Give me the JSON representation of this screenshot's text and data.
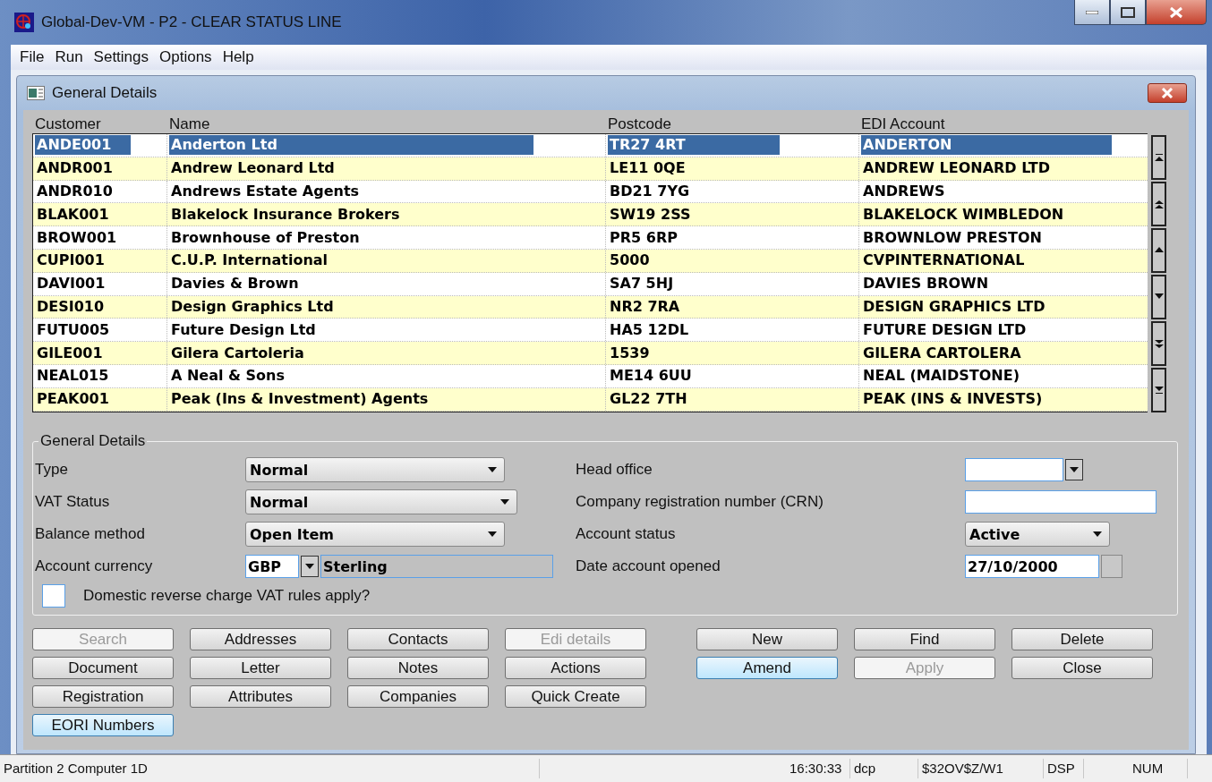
{
  "window": {
    "title": "Global-Dev-VM - P2 - CLEAR STATUS LINE"
  },
  "menu": [
    "File",
    "Run",
    "Settings",
    "Options",
    "Help"
  ],
  "child_window": {
    "title": "General Details"
  },
  "table": {
    "columns": [
      "Customer",
      "Name",
      "Postcode",
      "EDI Account"
    ],
    "rows": [
      {
        "cells": [
          "ANDE001",
          "Anderton Ltd",
          "TR27 4RT",
          "ANDERTON"
        ],
        "selected": true
      },
      {
        "cells": [
          "ANDR001",
          "Andrew Leonard Ltd",
          "LE11 0QE",
          "ANDREW LEONARD LTD"
        ],
        "selected": false
      },
      {
        "cells": [
          "ANDR010",
          "Andrews Estate Agents",
          "BD21 7YG",
          "ANDREWS"
        ],
        "selected": false
      },
      {
        "cells": [
          "BLAK001",
          "Blakelock Insurance Brokers",
          "SW19 2SS",
          "BLAKELOCK WIMBLEDON"
        ],
        "selected": false
      },
      {
        "cells": [
          "BROW001",
          "Brownhouse of Preston",
          "PR5 6RP",
          "BROWNLOW PRESTON"
        ],
        "selected": false
      },
      {
        "cells": [
          "CUPI001",
          "C.U.P. International",
          "5000",
          "CVPINTERNATIONAL"
        ],
        "selected": false
      },
      {
        "cells": [
          "DAVI001",
          "Davies & Brown",
          "SA7 5HJ",
          "DAVIES BROWN"
        ],
        "selected": false
      },
      {
        "cells": [
          "DESI010",
          "Design Graphics Ltd",
          "NR2 7RA",
          "DESIGN GRAPHICS LTD"
        ],
        "selected": false
      },
      {
        "cells": [
          "FUTU005",
          "Future Design Ltd",
          "HA5 12DL",
          "FUTURE DESIGN LTD"
        ],
        "selected": false
      },
      {
        "cells": [
          "GILE001",
          "Gilera Cartoleria",
          "1539",
          "GILERA CARTOLERA"
        ],
        "selected": false
      },
      {
        "cells": [
          "NEAL015",
          "A Neal & Sons",
          "ME14 6UU",
          "NEAL (MAIDSTONE)"
        ],
        "selected": false
      },
      {
        "cells": [
          "PEAK001",
          "Peak (Ins & Investment) Agents",
          "GL22 7TH",
          "PEAK (INS & INVESTS)"
        ],
        "selected": false
      }
    ]
  },
  "general_details": {
    "title": "General Details",
    "left_fields": [
      {
        "label": "Type",
        "kind": "select",
        "value": "Normal"
      },
      {
        "label": "VAT Status",
        "kind": "select",
        "value": "Normal"
      },
      {
        "label": "Balance method",
        "kind": "select",
        "value": "Open Item"
      },
      {
        "label": "Account currency",
        "kind": "currency",
        "value": "GBP",
        "description": "Sterling"
      }
    ],
    "right_fields": [
      {
        "label": "Head office",
        "kind": "combo"
      },
      {
        "label": "Company registration number (CRN)",
        "kind": "text"
      },
      {
        "label": "Account status",
        "kind": "select",
        "value": "Active"
      },
      {
        "label": "Date account opened",
        "kind": "date",
        "value": "27/10/2000"
      }
    ],
    "checkbox": {
      "label": "Domestic reverse charge VAT rules apply?",
      "checked": false
    }
  },
  "left_buttons": [
    {
      "label": "Search",
      "disabled": true,
      "focused": false
    },
    {
      "label": "Addresses",
      "disabled": false,
      "focused": false
    },
    {
      "label": "Contacts",
      "disabled": false,
      "focused": false
    },
    {
      "label": "Edi details",
      "disabled": true,
      "focused": false
    },
    {
      "label": "Document",
      "disabled": false,
      "focused": false
    },
    {
      "label": "Letter",
      "disabled": false,
      "focused": false
    },
    {
      "label": "Notes",
      "disabled": false,
      "focused": false
    },
    {
      "label": "Actions",
      "disabled": false,
      "focused": false
    },
    {
      "label": "Registration",
      "disabled": false,
      "focused": false
    },
    {
      "label": "Attributes",
      "disabled": false,
      "focused": false
    },
    {
      "label": "Companies",
      "disabled": false,
      "focused": false
    },
    {
      "label": "Quick Create",
      "disabled": false,
      "focused": false
    },
    {
      "label": "EORI Numbers",
      "disabled": false,
      "focused": true
    }
  ],
  "right_buttons": [
    {
      "label": "New",
      "disabled": false,
      "focused": false
    },
    {
      "label": "Find",
      "disabled": false,
      "focused": false
    },
    {
      "label": "Delete",
      "disabled": false,
      "focused": false
    },
    {
      "label": "Amend",
      "disabled": false,
      "focused": true
    },
    {
      "label": "Apply",
      "disabled": true,
      "focused": false
    },
    {
      "label": "Close",
      "disabled": false,
      "focused": false
    }
  ],
  "status_bar": [
    "Partition 2 Computer 1D",
    "16:30:33",
    "dcp",
    "$32OV$Z/W1",
    "DSP",
    "NUM"
  ]
}
